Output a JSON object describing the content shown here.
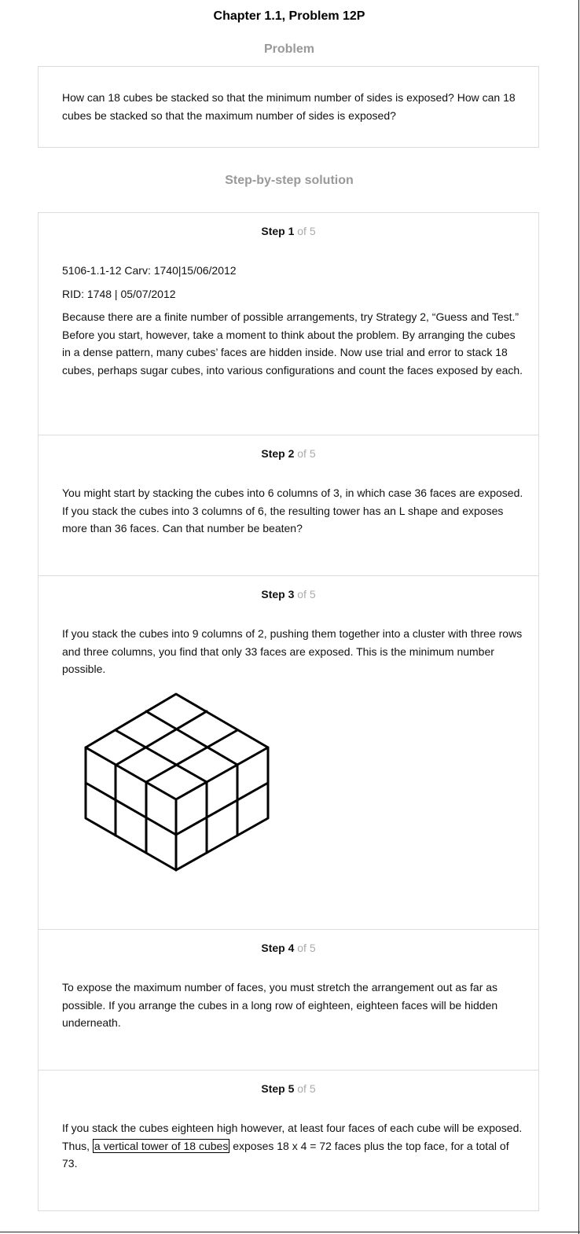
{
  "header": {
    "title": "Chapter 1.1, Problem 12P"
  },
  "problem": {
    "heading": "Problem",
    "text": "How can 18 cubes be stacked so that the minimum number of sides is exposed? How can 18 cubes be stacked so that the maximum number of sides is exposed?"
  },
  "solution": {
    "heading": "Step-by-step solution"
  },
  "steps": [
    {
      "label": "Step 1",
      "of": "of 5",
      "meta1": "5106-1.1-12 Carv: 1740|15/06/2012",
      "meta2": "RID: 1748 | 05/07/2012",
      "text": "Because there are a finite number of possible arrangements, try Strategy 2, “Guess and Test.” Before you start, however, take a moment to think about the problem. By arranging the cubes in a dense pattern, many cubes’ faces are hidden inside. Now use trial and error to stack 18 cubes, perhaps sugar cubes, into various configurations and count the faces exposed by each."
    },
    {
      "label": "Step 2",
      "of": "of 5",
      "text": "You might start by stacking the cubes into 6 columns of 3, in which case 36 faces are exposed. If you stack the cubes into 3 columns of 6, the resulting tower has an L shape and exposes more than 36 faces. Can that number be beaten?"
    },
    {
      "label": "Step 3",
      "of": "of 5",
      "text": "If you stack the cubes into 9 columns of 2, pushing them together into a cluster with three rows and three columns, you find that only 33 faces are exposed. This is the minimum number possible."
    },
    {
      "label": "Step 4",
      "of": "of 5",
      "text": "To expose the maximum number of faces, you must stretch the arrangement out as far as possible. If you arrange the cubes in a long row of eighteen, eighteen faces will be hidden underneath."
    },
    {
      "label": "Step 5",
      "of": "of 5",
      "text_before": "If you stack the cubes eighteen high however, at least four faces of each cube will be exposed. Thus, ",
      "highlight": "a vertical tower of 18 cubes",
      "text_after": " exposes 18 x 4 = 72 faces plus the top face, for a total of 73."
    }
  ]
}
